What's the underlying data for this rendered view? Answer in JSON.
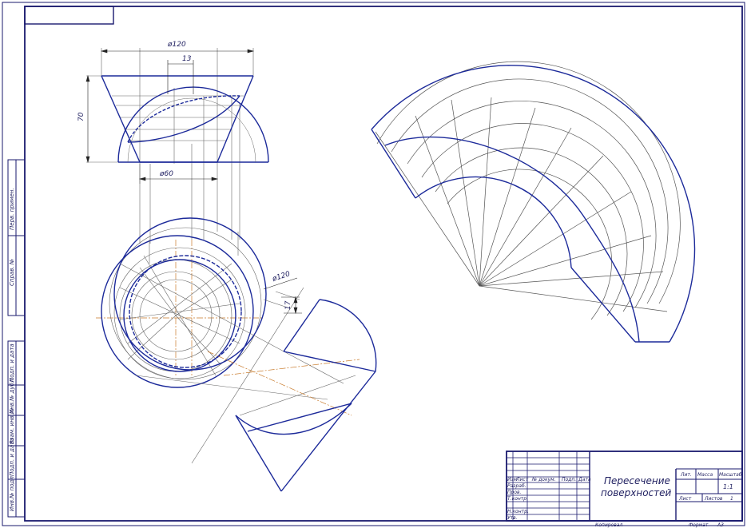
{
  "drawing": {
    "dimensions": {
      "outer_diameter": "ø120",
      "offset": "13",
      "height": "70",
      "inner_diameter": "ø60",
      "plan_diameter": "ø120",
      "plan_offset": "17"
    }
  },
  "side_stamp": {
    "labels": [
      "Инв.№ подл.",
      "Подп. и дата",
      "Взам. инв.№",
      "Инв.№ дубл.",
      "Подп. и дата",
      "Справ. №",
      "Перв. примен."
    ]
  },
  "title_block": {
    "title_line1": "Пересечение",
    "title_line2": "поверхностей",
    "col_headers": [
      "Изм",
      "Лист",
      "№ докум.",
      "Подп.",
      "Дата"
    ],
    "row_labels": [
      "Разраб.",
      "Пров.",
      "Т.контр.",
      "",
      "Н.контр.",
      "Утв."
    ],
    "lit_label": "Лит.",
    "mass_label": "Масса",
    "scale_label": "Масштаб",
    "scale_value": "1:1",
    "sheet_label": "Лист",
    "sheets_label": "Листов",
    "sheets_value": "1",
    "copied_label": "Копировал",
    "format_label": "Формат",
    "format_value": "А3"
  },
  "colors": {
    "frame": "#1a1a6e",
    "contour": "#1c2a9a",
    "thin": "#555555",
    "axis": "#c87a2a"
  }
}
